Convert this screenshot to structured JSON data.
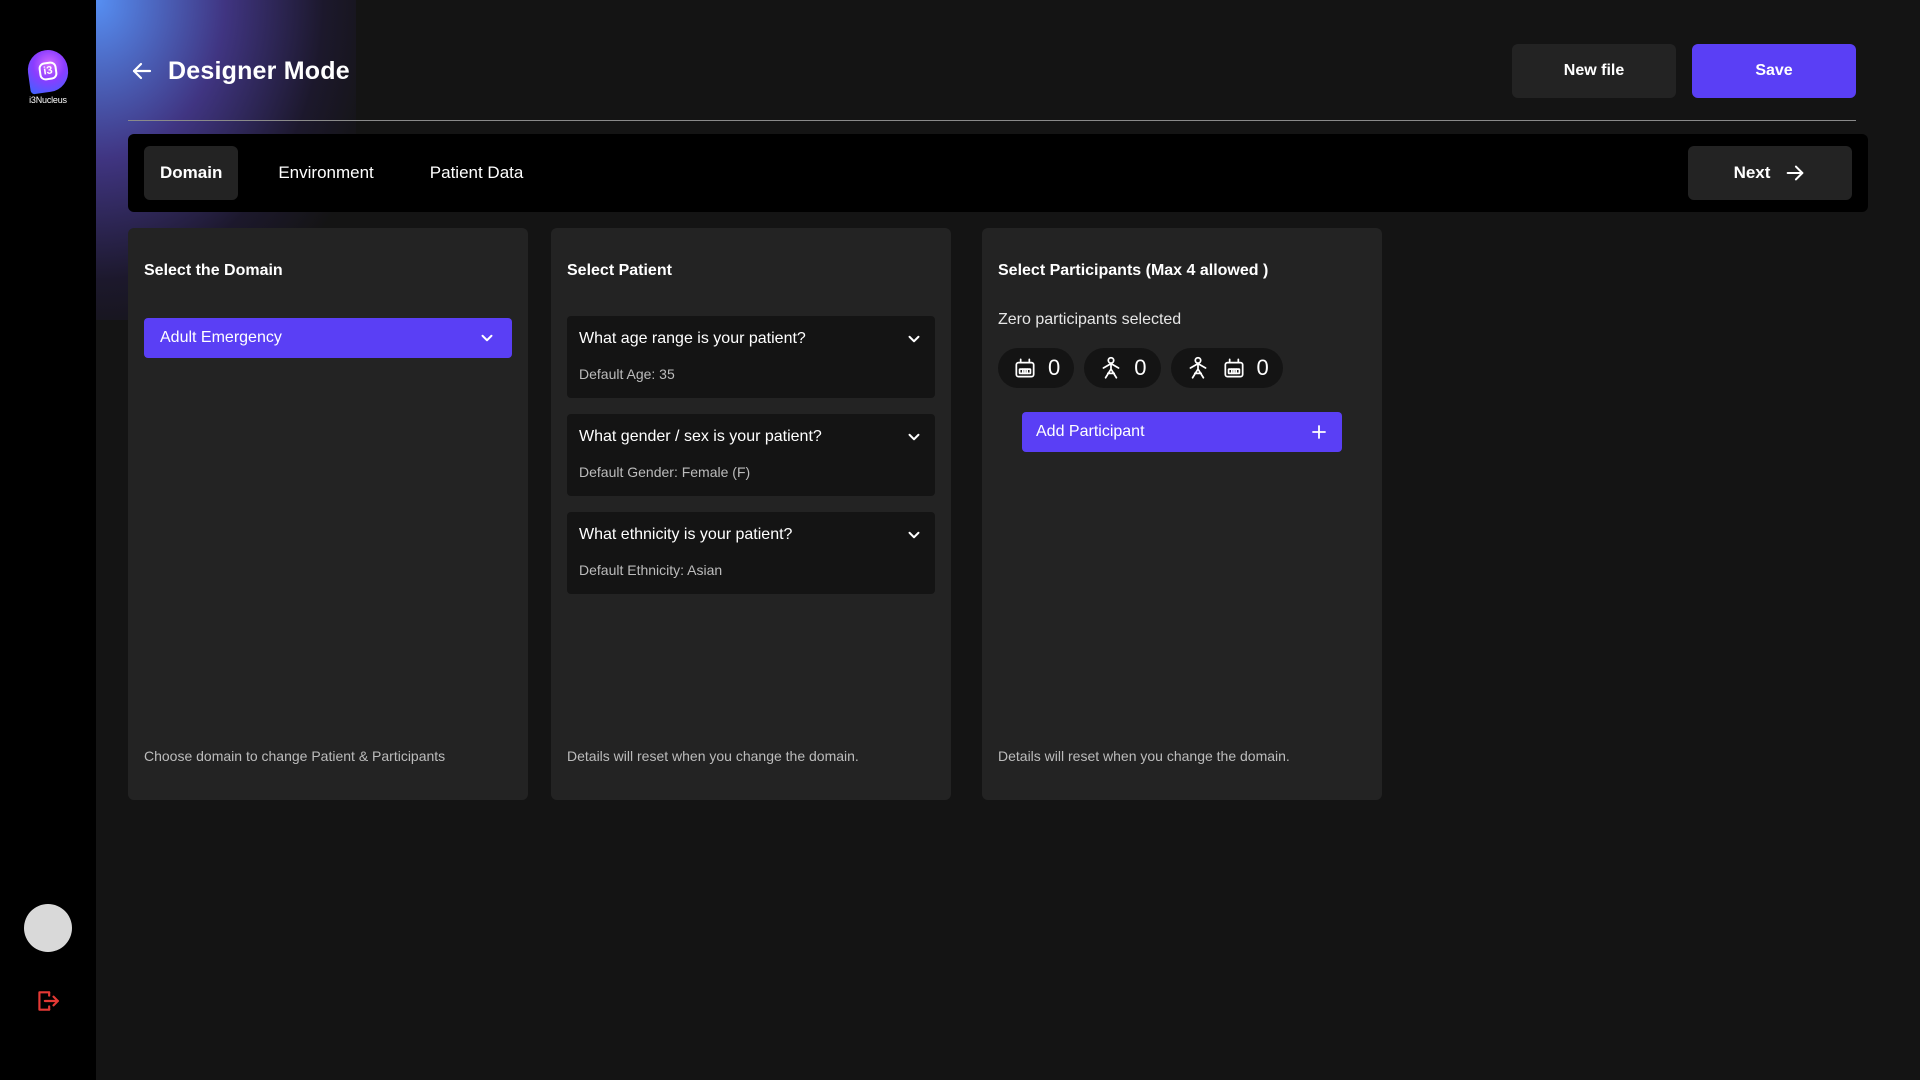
{
  "sidebar": {
    "logo_text": "i3Nucleus",
    "logo_glyph": "i3"
  },
  "header": {
    "title": "Designer Mode",
    "new_file_label": "New file",
    "save_label": "Save"
  },
  "tabs": [
    {
      "label": "Domain",
      "active": true
    },
    {
      "label": "Environment",
      "active": false
    },
    {
      "label": "Patient Data",
      "active": false
    }
  ],
  "next_label": "Next",
  "domain_panel": {
    "title": "Select the Domain",
    "selected": "Adult Emergency",
    "footer": "Choose domain to change Patient & Participants"
  },
  "patient_panel": {
    "title": "Select Patient",
    "questions": [
      {
        "question": "What age range is your patient?",
        "default": "Default Age: 35"
      },
      {
        "question": "What gender / sex is your patient?",
        "default": "Default Gender: Female (F)"
      },
      {
        "question": "What ethnicity is your patient?",
        "default": "Default Ethnicity: Asian"
      }
    ],
    "footer": "Details will reset when you change the domain."
  },
  "participants_panel": {
    "title": "Select Participants (Max 4 allowed )",
    "status": "Zero participants selected",
    "counters": [
      {
        "icons": [
          "robot-icon"
        ],
        "value": "0"
      },
      {
        "icons": [
          "person-icon"
        ],
        "value": "0"
      },
      {
        "icons": [
          "person-icon",
          "robot-icon"
        ],
        "value": "0"
      }
    ],
    "add_label": "Add Participant",
    "footer": "Details will reset when you change the domain."
  },
  "colors": {
    "accent": "#5a3ff5",
    "background": "#141414",
    "panel": "#232323",
    "sidebar": "#000000",
    "logout": "#e53935"
  }
}
